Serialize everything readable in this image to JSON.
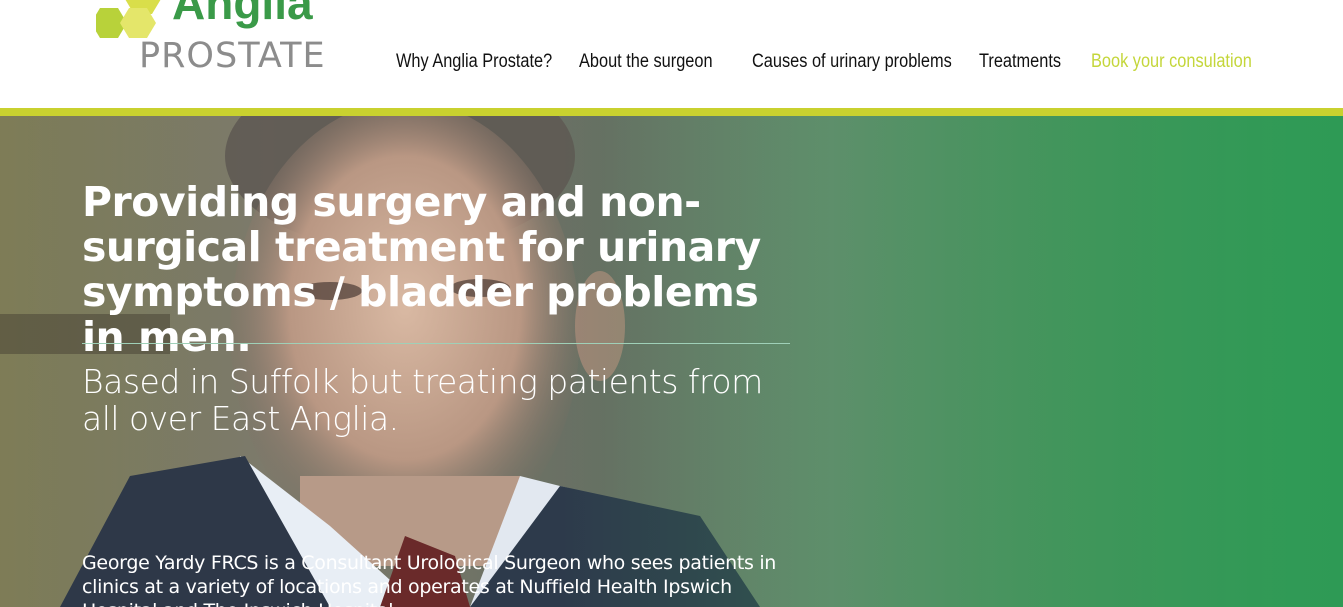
{
  "brand": {
    "name": "Anglia",
    "tagline": "PROSTATE",
    "logo_icon": "hexagon-cluster-icon",
    "colors": {
      "green": "#3a9a48",
      "lime": "#c4d63a",
      "grey": "#8c8c8c"
    }
  },
  "nav": {
    "items": [
      {
        "label": "Why Anglia Prostate?",
        "active": false
      },
      {
        "label": "About the surgeon",
        "active": false
      },
      {
        "label": "Causes of urinary problems",
        "active": false
      },
      {
        "label": "Treatments",
        "active": false
      },
      {
        "label": "Book your consulation",
        "active": true
      }
    ]
  },
  "hero": {
    "title": "Providing surgery and non-surgical treatment for urinary symptoms / bladder problems in men.",
    "subtitle": "Based in Suffolk but treating patients from all over East Anglia.",
    "body": "George Yardy FRCS is a Consultant Urological Surgeon who sees patients in clinics at a variety of locations and operates at Nuffield Health Ipswich Hospital and The Ipswich Hospital.",
    "image": "surgeon-portrait",
    "accent_bar_color": "#c9d12f"
  }
}
